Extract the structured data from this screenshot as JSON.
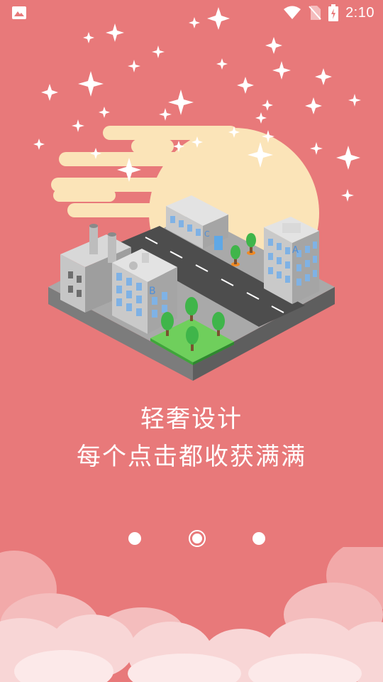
{
  "status_bar": {
    "time": "2:10",
    "icons": [
      "gallery-icon",
      "wifi-icon",
      "no-sim-icon",
      "battery-charging-icon"
    ]
  },
  "illustration": {
    "building_labels": [
      "A",
      "B",
      "C"
    ]
  },
  "onboarding": {
    "title": "轻奢设计",
    "subtitle": "每个点击都收获满满",
    "page_count": 3,
    "current_page": 2
  },
  "colors": {
    "background": "#E8797A",
    "moon": "#FBE4B8",
    "clouds": "#F7D2D2"
  }
}
